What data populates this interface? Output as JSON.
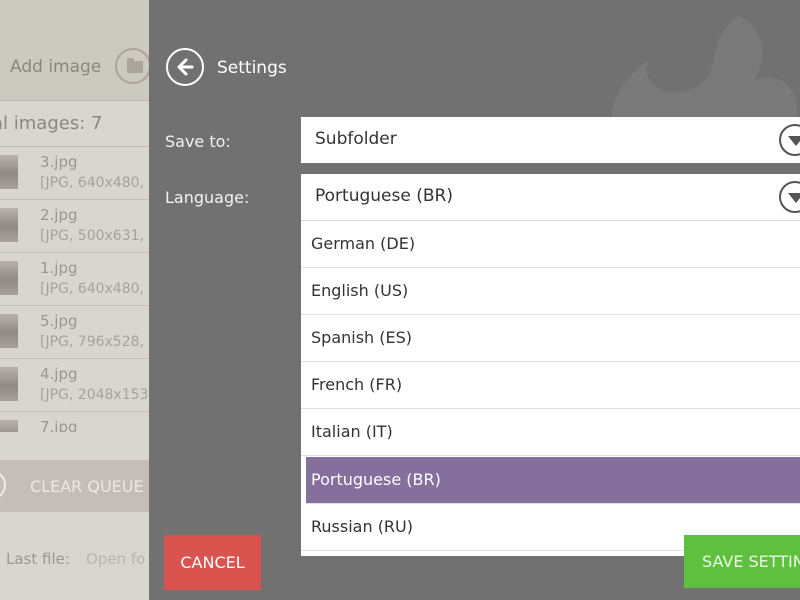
{
  "left_panel": {
    "add_image_label": "Add image",
    "total_images_label": "al images: 7",
    "files": [
      {
        "name": "3.jpg",
        "meta": "[JPG, 640x480,"
      },
      {
        "name": "2.jpg",
        "meta": "[JPG, 500x631,"
      },
      {
        "name": "1.jpg",
        "meta": "[JPG, 640x480,"
      },
      {
        "name": "5.jpg",
        "meta": "[JPG, 796x528,"
      },
      {
        "name": "4.jpg",
        "meta": "[JPG, 2048x153"
      },
      {
        "name": "7.jpg",
        "meta": ""
      }
    ],
    "clear_queue_label": "CLEAR QUEUE",
    "last_file_label": "Last file:",
    "open_folder_label": "Open fo"
  },
  "settings": {
    "title": "Settings",
    "save_to": {
      "label": "Save to:",
      "value": "Subfolder"
    },
    "language": {
      "label": "Language:",
      "value": "Portuguese (BR)",
      "options": [
        "German (DE)",
        "English (US)",
        "Spanish (ES)",
        "French (FR)",
        "Italian (IT)",
        "Portuguese (BR)",
        "Russian (RU)"
      ],
      "selected": "Portuguese (BR)"
    },
    "cancel_label": "CANCEL",
    "save_label": "SAVE SETTIN"
  },
  "colors": {
    "overlay_bg": "#717171",
    "selected_option": "#856f9c",
    "cancel": "#d9534f",
    "save": "#5fbf3f"
  }
}
